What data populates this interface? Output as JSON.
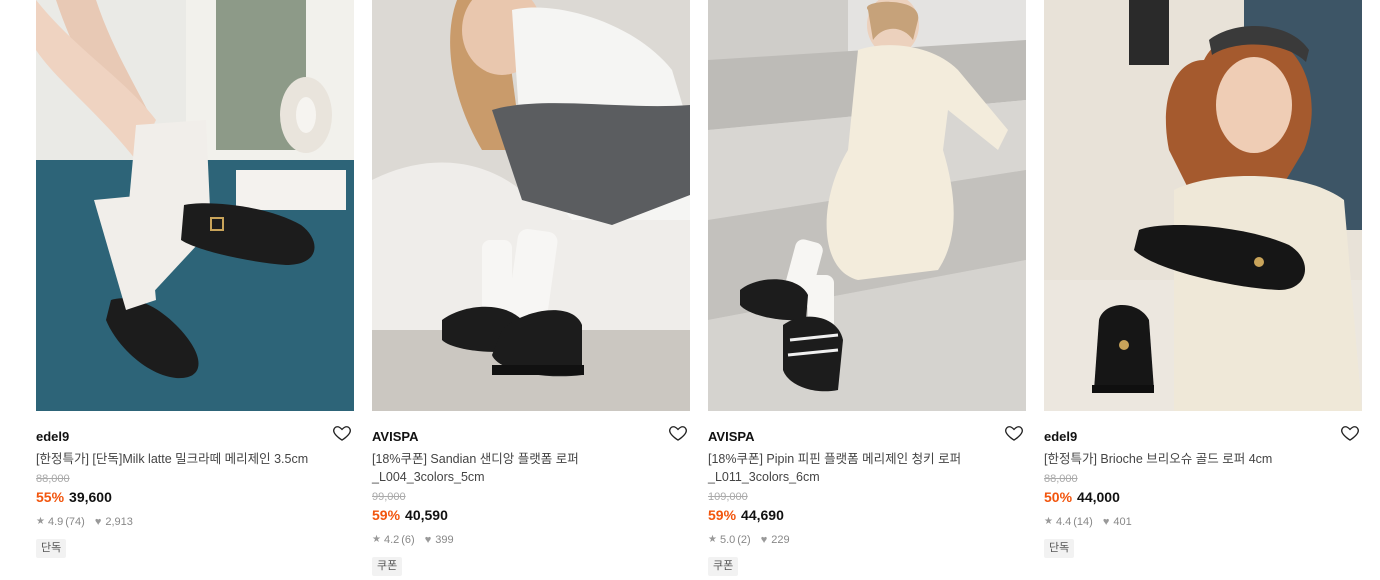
{
  "products": [
    {
      "brand": "edel9",
      "name": "[한정특가] [단독]Milk latte 밀크라떼 메리제인 3.5cm",
      "original_price": "88,000",
      "discount": "55%",
      "price": "39,600",
      "rating": "4.9",
      "reviews": "(74)",
      "likes": "2,913",
      "badge": "단독"
    },
    {
      "brand": "AVISPA",
      "name": "[18%쿠폰] Sandian 샌디앙 플랫폼 로퍼 _L004_3colors_5cm",
      "original_price": "99,000",
      "discount": "59%",
      "price": "40,590",
      "rating": "4.2",
      "reviews": "(6)",
      "likes": "399",
      "badge": "쿠폰"
    },
    {
      "brand": "AVISPA",
      "name": "[18%쿠폰] Pipin 피핀 플랫폼 메리제인 청키 로퍼 _L011_3colors_6cm",
      "original_price": "109,000",
      "discount": "59%",
      "price": "44,690",
      "rating": "5.0",
      "reviews": "(2)",
      "likes": "229",
      "badge": "쿠폰"
    },
    {
      "brand": "edel9",
      "name": "[한정특가] Brioche 브리오슈 골드 로퍼 4cm",
      "original_price": "88,000",
      "discount": "50%",
      "price": "44,000",
      "rating": "4.4",
      "reviews": "(14)",
      "likes": "401",
      "badge": "단독"
    }
  ],
  "colors": {
    "discount": "#f2550d",
    "text": "#222222",
    "muted": "#aaaaaa"
  },
  "icons": {
    "wishlist": "heart-outline-icon",
    "rating": "star-icon",
    "likes": "heart-filled-icon"
  }
}
